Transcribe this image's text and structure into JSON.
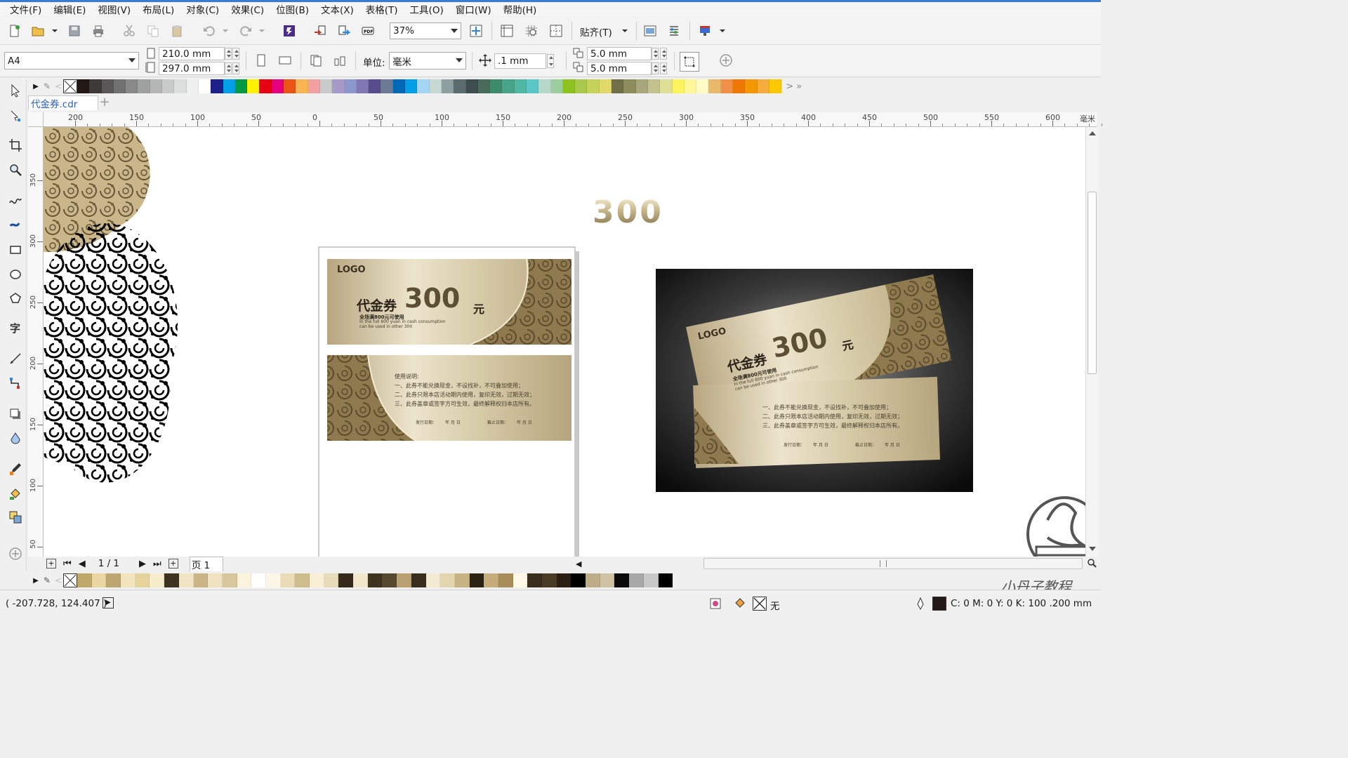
{
  "menu": [
    "文件(F)",
    "编辑(E)",
    "视图(V)",
    "布局(L)",
    "对象(C)",
    "效果(C)",
    "位图(B)",
    "文本(X)",
    "表格(T)",
    "工具(O)",
    "窗口(W)",
    "帮助(H)"
  ],
  "toolbar": {
    "zoom": "37%",
    "snap_label": "贴齐(T)"
  },
  "property_bar": {
    "page_size": "A4",
    "width": "210.0 mm",
    "height": "297.0 mm",
    "units_label": "单位:",
    "units_value": "毫米",
    "nudge": ".1 mm",
    "dup_x": "5.0 mm",
    "dup_y": "5.0 mm"
  },
  "document_tab": "代金券.cdr",
  "ruler": {
    "h_unit": "毫米",
    "h_ticks": [
      "200",
      "150",
      "100",
      "50",
      "0",
      "50",
      "100",
      "150",
      "200",
      "250",
      "300",
      "350",
      "400",
      "450",
      "500",
      "550",
      "600"
    ],
    "v_ticks": [
      "350",
      "300",
      "250",
      "200",
      "150",
      "100",
      "50"
    ]
  },
  "canvas": {
    "number_300": "300",
    "front_card": {
      "logo": "LOGO",
      "title": "代金券",
      "amount": "300",
      "currency": "元",
      "tagline_cn": "全场满800元可使用",
      "tagline_en1": "In the full 800 yuan in cash consumption",
      "tagline_en2": "can be used in other 300"
    },
    "back_card": {
      "heading": "使用说明:",
      "rule1": "一、此券不能兑换现金，不设找补，不可叠加使用；",
      "rule2": "二、此券只限本店活动期内使用，复印无效，过期无效；",
      "rule3": "三、此券盖章或签字方可生效，最终解释权归本店所有。",
      "issue_label": "发行日期：",
      "issue_value": "年  月  日",
      "expire_label": "截止日期：",
      "expire_value": "年  月  日"
    }
  },
  "pager": {
    "page_count": "1 / 1",
    "page_tab": "页 1"
  },
  "status": {
    "coords": "( -207.728, 124.407 )",
    "fill_none": "无",
    "outline_info": "C: 0 M: 0 Y: 0 K: 100  .200 mm"
  },
  "watermark_text": "小丹子教程",
  "colors": {
    "accent": "#3a7bd5",
    "gold": "#c8b890",
    "dark_bg": "#2a2a2a"
  }
}
